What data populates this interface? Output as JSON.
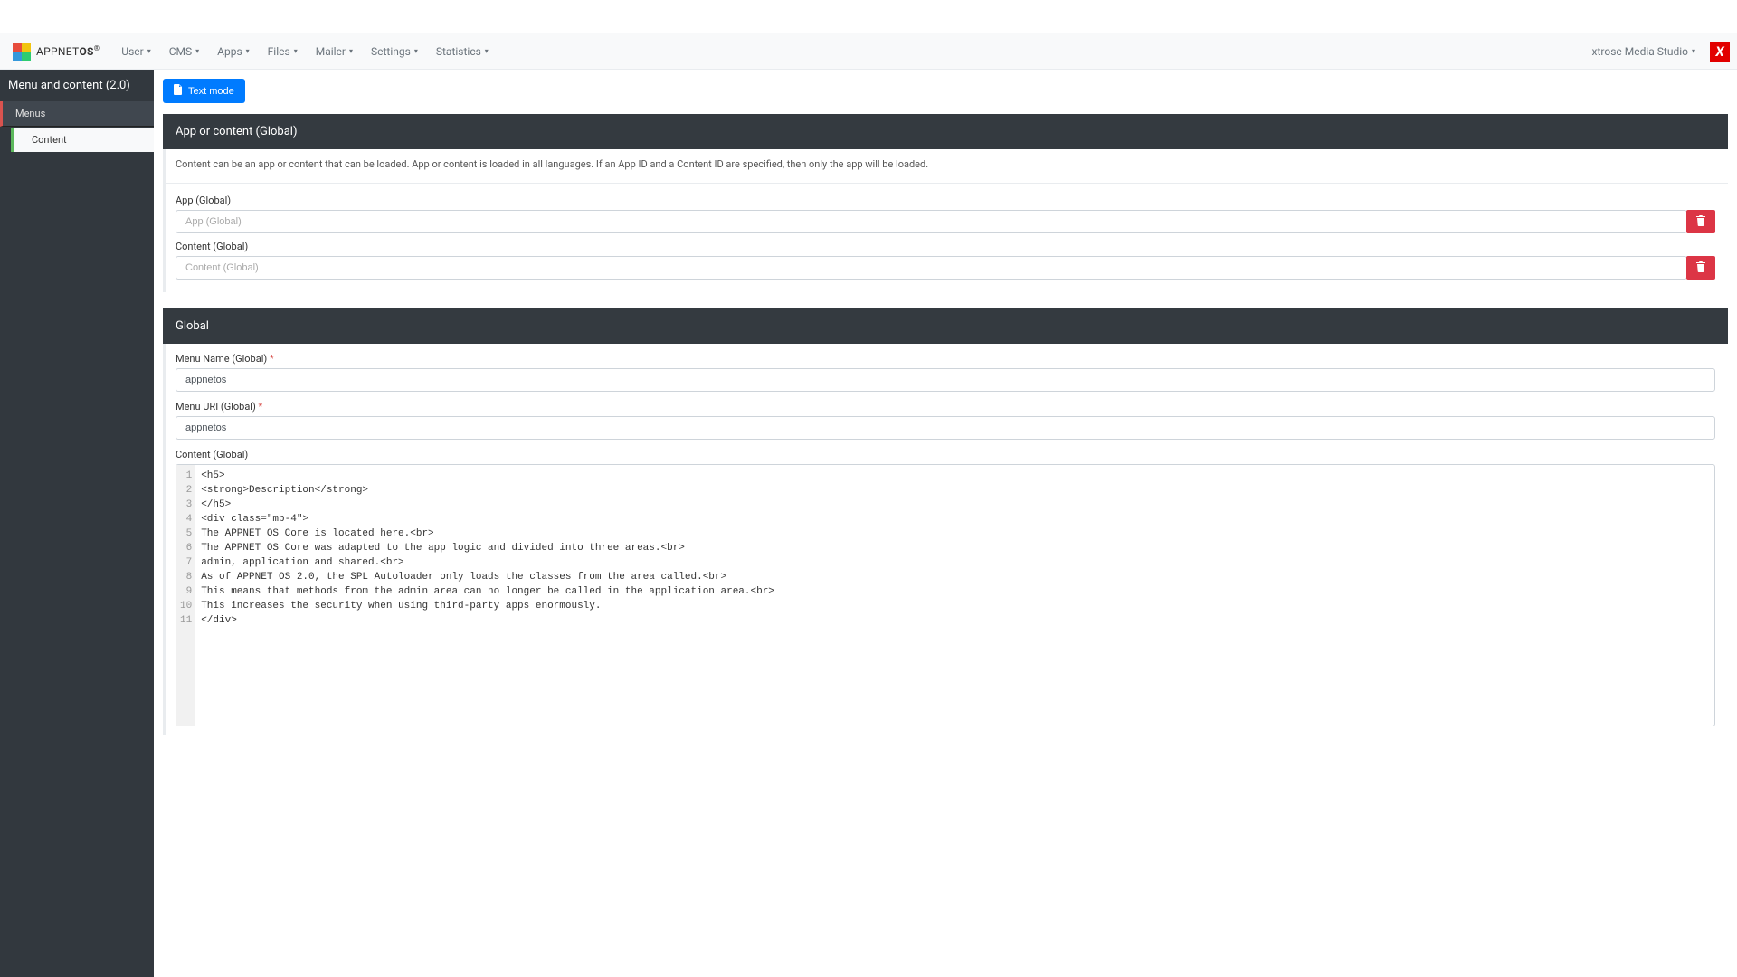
{
  "brand": {
    "name_thin": "APPNET",
    "name_bold": "OS",
    "reg": "®"
  },
  "nav": {
    "items": [
      {
        "label": "User"
      },
      {
        "label": "CMS"
      },
      {
        "label": "Apps"
      },
      {
        "label": "Files"
      },
      {
        "label": "Mailer"
      },
      {
        "label": "Settings"
      },
      {
        "label": "Statistics"
      }
    ],
    "account": "xtrose Media Studio"
  },
  "sidebar": {
    "title": "Menu and content (2.0)",
    "items": [
      {
        "label": "Menus",
        "kind": "item-red"
      },
      {
        "label": "Content",
        "kind": "subitem"
      }
    ]
  },
  "textModeButton": "Text mode",
  "panelAppContent": {
    "title": "App or content (Global)",
    "description": "Content can be an app or content that can be loaded. App or content is loaded in all languages. If an App ID and a Content ID are specified, then only the app will be loaded.",
    "appLabel": "App (Global)",
    "appPlaceholder": "App (Global)",
    "contentLabel": "Content (Global)",
    "contentPlaceholder": "Content (Global)"
  },
  "panelGlobal": {
    "title": "Global",
    "menuNameLabel": "Menu Name (Global)",
    "menuNameValue": "appnetos",
    "menuUriLabel": "Menu URI (Global)",
    "menuUriValue": "appnetos",
    "contentLabel": "Content (Global)",
    "codeLines": [
      "<h5>",
      "<strong>Description</strong>",
      "</h5>",
      "<div class=\"mb-4\">",
      "The APPNET OS Core is located here.<br>",
      "The APPNET OS Core was adapted to the app logic and divided into three areas.<br>",
      "admin, application and shared.<br>",
      "As of APPNET OS 2.0, the SPL Autoloader only loads the classes from the area called.<br>",
      "This means that methods from the admin area can no longer be called in the application area.<br>",
      "This increases the security when using third-party apps enormously.",
      "</div>"
    ]
  }
}
